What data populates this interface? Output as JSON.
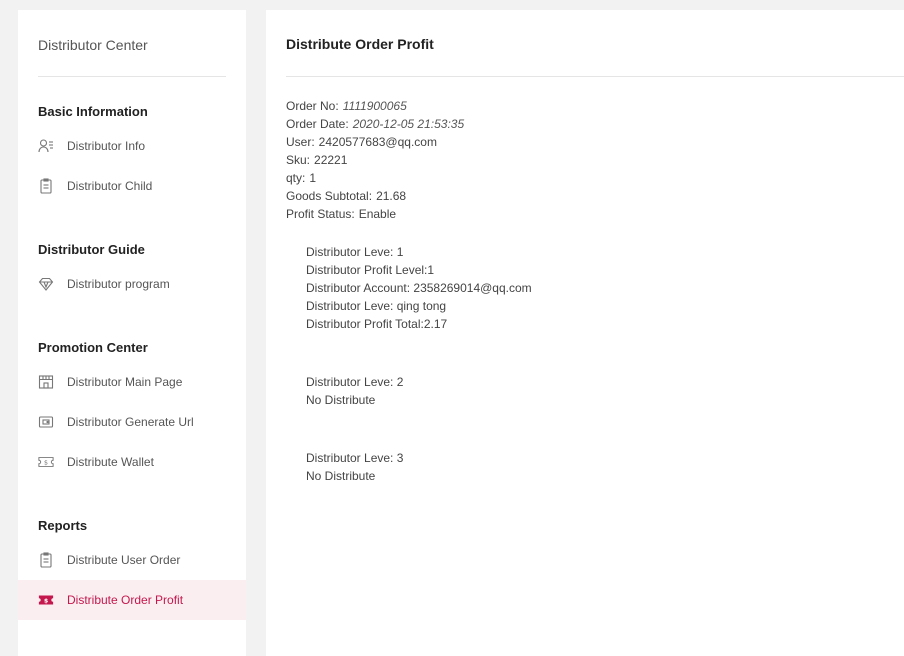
{
  "sidebar": {
    "title": "Distributor Center",
    "sections": [
      {
        "title": "Basic Information",
        "items": [
          {
            "label": "Distributor Info",
            "icon": "user-list-icon"
          },
          {
            "label": "Distributor Child",
            "icon": "document-icon"
          }
        ]
      },
      {
        "title": "Distributor Guide",
        "items": [
          {
            "label": "Distributor program",
            "icon": "diamond-icon"
          }
        ]
      },
      {
        "title": "Promotion Center",
        "items": [
          {
            "label": "Distributor Main Page",
            "icon": "store-icon"
          },
          {
            "label": "Distributor Generate Url",
            "icon": "wallet-icon"
          },
          {
            "label": "Distribute Wallet",
            "icon": "ticket-dollar-icon"
          }
        ]
      },
      {
        "title": "Reports",
        "items": [
          {
            "label": "Distribute User Order",
            "icon": "document-icon"
          },
          {
            "label": "Distribute Order Profit",
            "icon": "ticket-dollar-icon",
            "active": true
          }
        ]
      }
    ]
  },
  "main": {
    "title": "Distribute Order Profit",
    "order": {
      "order_no_label": "Order No:",
      "order_no": "1111900065",
      "order_date_label": "Order Date:",
      "order_date": "2020-12-05 21:53:35",
      "user_label": "User:",
      "user": "2420577683@qq.com",
      "sku_label": "Sku:",
      "sku": "22221",
      "qty_label": "qty:",
      "qty": "1",
      "subtotal_label": "Goods Subtotal:",
      "subtotal": "21.68",
      "status_label": "Profit Status:",
      "status": "Enable"
    },
    "levels": [
      {
        "level_label": "Distributor Leve:",
        "level": "1",
        "profit_level_label": "Distributor Profit Level:",
        "profit_level": "1",
        "account_label": "Distributor Account:",
        "account": "2358269014@qq.com",
        "name_label": "Distributor Leve:",
        "name": "qing tong",
        "total_label": "Distributor Profit Total:",
        "total": "2.17"
      },
      {
        "level_label": "Distributor Leve:",
        "level": "2",
        "note": "No Distribute"
      },
      {
        "level_label": "Distributor Leve:",
        "level": "3",
        "note": "No Distribute"
      }
    ]
  },
  "colors": {
    "accent": "#c4174d",
    "active_bg": "#fbeef1",
    "page_bg": "#f2f2f2"
  }
}
